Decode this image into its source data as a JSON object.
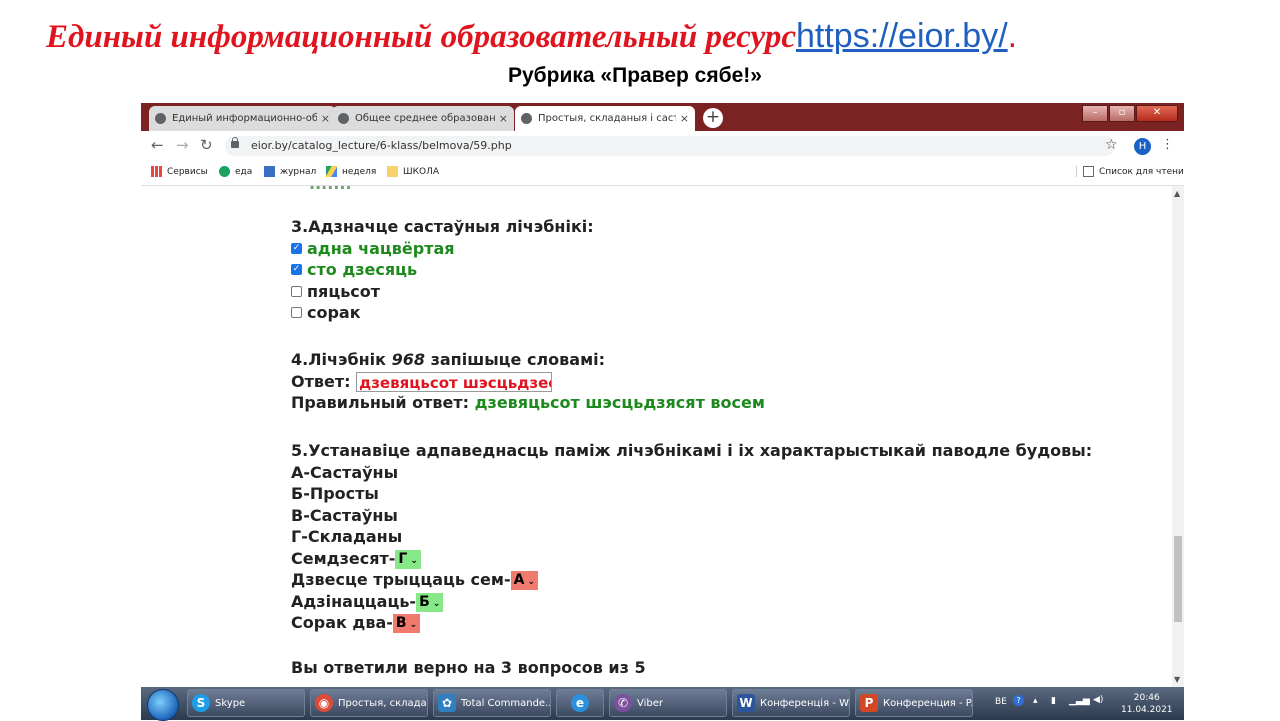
{
  "slide": {
    "title_main": "Единый информационный образовательный ресурс",
    "title_link": "https://eior.by/",
    "title_end": ".",
    "subtitle": "Рубрика «Правер сябе!»"
  },
  "browser": {
    "tabs": [
      {
        "label": "Единый информационно-образ",
        "close": "×"
      },
      {
        "label": "Общее среднее образование",
        "close": "×"
      },
      {
        "label": "Простыя, складаныя і састаўны",
        "close": "×"
      }
    ],
    "new_tab": "+",
    "url": "eior.by/catalog_lecture/6-klass/belmova/59.php",
    "profile_initial": "Н",
    "bookmarks": [
      "Сервисы",
      "еда",
      "журнал",
      "неделя",
      "ШКОЛА"
    ],
    "reading_list": "Список для чтения"
  },
  "quiz": {
    "q3": {
      "title": "3.Адзначце састаўныя лічэбнікі:",
      "options": [
        {
          "label": "адна чацвёртая",
          "checked": true
        },
        {
          "label": "сто дзесяць",
          "checked": true
        },
        {
          "label": "пяцьсот",
          "checked": false
        },
        {
          "label": "сорак",
          "checked": false
        }
      ]
    },
    "q4": {
      "title_prefix": "4.Лічэбнік ",
      "number": "968",
      "title_suffix": " запішыце словамі:",
      "answer_label": "Ответ: ",
      "answer_value": "дзевяцьсот шэсцьдзесят",
      "correct_label": "Правильный ответ: ",
      "correct_value": "дзевяцьсот шэсцьдзясят восем"
    },
    "q5": {
      "title": "5.Устанавіце адпаведнасць паміж лічэбнікамі і іх характарыстыкай паводле будовы:",
      "options": [
        "А-Састаўны",
        "Б-Просты",
        "В-Састаўны",
        "Г-Складаны"
      ],
      "matches": [
        {
          "label": "Семдзесят-",
          "value": "Г",
          "status": "correct"
        },
        {
          "label": "Дзвесце трыццаць сем-",
          "value": "А",
          "status": "wrong"
        },
        {
          "label": "Адзінаццаць-",
          "value": "Б",
          "status": "correct"
        },
        {
          "label": "Сорак два-",
          "value": "В",
          "status": "wrong"
        }
      ]
    },
    "result": "Вы ответили верно на 3 вопросов из 5"
  },
  "taskbar": {
    "items": [
      {
        "label": "Skype",
        "icon_name": "skype-icon",
        "color": "#1e9ee8",
        "glyph": "S"
      },
      {
        "label": "Простыя, склада...",
        "icon_name": "chrome-icon",
        "color": "#dd4b39",
        "glyph": "◉"
      },
      {
        "label": "Total Commande...",
        "icon_name": "total-commander-icon",
        "color": "#2f7fc1",
        "glyph": "✿"
      },
      {
        "label": "",
        "icon_name": "internet-explorer-icon",
        "color": "#2a8fdc",
        "glyph": "e"
      },
      {
        "label": "Viber",
        "icon_name": "viber-icon",
        "color": "#7b519d",
        "glyph": "✆"
      },
      {
        "label": "Конференція - W...",
        "icon_name": "word-icon",
        "color": "#2b579a",
        "glyph": "W"
      },
      {
        "label": "Конференция - P...",
        "icon_name": "powerpoint-icon",
        "color": "#d24726",
        "glyph": "P"
      }
    ],
    "language": "BE",
    "time": "20:46",
    "date": "11.04.2021"
  },
  "colors": {
    "title_red": "#e0141e",
    "link_blue": "#1f5fbf",
    "correct_green": "#1e8a1e",
    "select_correct_bg": "#86e886",
    "select_wrong_bg": "#f07a6e",
    "tabbar_bg": "#7a2322"
  }
}
